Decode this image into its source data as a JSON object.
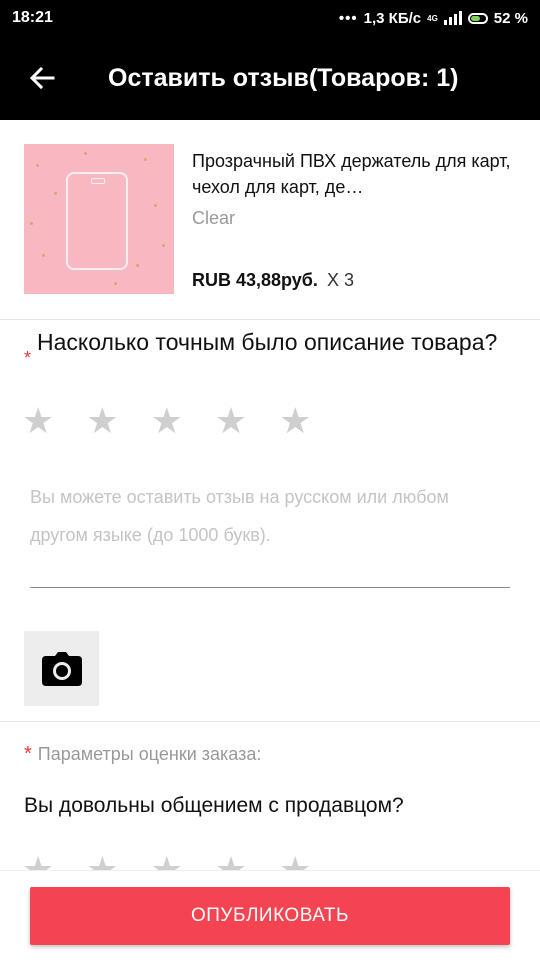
{
  "status_bar": {
    "time": "18:21",
    "network_speed": "1,3 КБ/с",
    "network_type": "4G",
    "battery": "52 %"
  },
  "header": {
    "back_icon": "arrow-left-icon",
    "title": "Оставить отзыв(Товаров: 1)"
  },
  "product": {
    "name": "Прозрачный ПВХ держатель для карт, чехол для карт, де…",
    "variant": "Clear",
    "price": "RUB 43,88руб.",
    "quantity": "X 3"
  },
  "question1": {
    "required_mark": "*",
    "text": "Насколько точным было описание товара?",
    "rating": 0,
    "max_rating": 5
  },
  "review": {
    "value": "",
    "placeholder": "Вы можете оставить отзыв на русском или любом другом языке (до 1000 букв)."
  },
  "photo": {
    "icon": "camera-icon"
  },
  "rating_params": {
    "required_mark": "*",
    "label": "Параметры оценки заказа:",
    "question": "Вы довольны общением с продавцом?",
    "rating": 0,
    "max_rating": 5
  },
  "publish": {
    "label": "ОПУБЛИКОВАТЬ"
  },
  "colors": {
    "header_bg": "#000000",
    "accent": "#f44452",
    "required": "#e53935",
    "star_empty": "#cfcfcf"
  }
}
